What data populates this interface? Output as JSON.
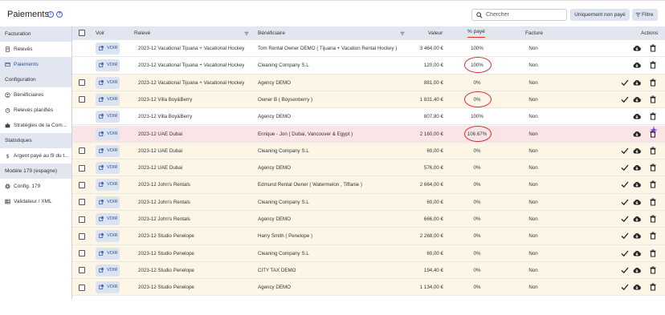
{
  "header": {
    "title": "Paiements",
    "info_glyph": "i",
    "help_glyph": "?",
    "search_placeholder": "Chercher",
    "unpaid_button": "Uniquement non payé",
    "filter_button": "Filtre"
  },
  "sidebar": {
    "sections": [
      {
        "label": "Facturation",
        "items": [
          {
            "label": "Relevés",
            "icon": "document-icon"
          },
          {
            "label": "Paiements",
            "icon": "card-icon",
            "active": true
          }
        ]
      },
      {
        "label": "Configuration",
        "items": [
          {
            "label": "Bénéficiaires",
            "icon": "person-icon"
          },
          {
            "label": "Relevés planifiés",
            "icon": "clock-icon"
          },
          {
            "label": "Stratégies de la Com...",
            "icon": "puzzle-icon"
          }
        ]
      },
      {
        "label": "Statistiques",
        "items": [
          {
            "label": "Argent payé au fil du t...",
            "icon": "dollar-icon"
          }
        ]
      },
      {
        "label": "Modèle 179 (espagne)",
        "items": [
          {
            "label": "Config. 179",
            "icon": "gear-icon"
          },
          {
            "label": "Validateur / XML",
            "icon": "table-icon"
          }
        ]
      }
    ]
  },
  "table": {
    "columns": {
      "voir": "Voir",
      "releve": "Relevé",
      "beneficiaire": "Bénéficiaire",
      "valeur": "Valeur",
      "pct": "% payé",
      "facture": "Facture",
      "actions": "Actions"
    },
    "voir_label": "VOIR",
    "rows": [
      {
        "releve": "2023-12 Vacational Tijuana + Vacational Hockey",
        "beneficiaire": "Tom Rental Owner DEMO ( Tijuana + Vacation Rental Hockey )",
        "valeur": "3 464,00 €",
        "pct": "100%",
        "facture": "Non",
        "bg": "white",
        "checkbox": false,
        "check": false
      },
      {
        "releve": "2023-12 Vacational Tijuana + Vacational Hockey",
        "beneficiaire": "Cleaning Company S.L",
        "valeur": "120,00 €",
        "pct": "100%",
        "facture": "Non",
        "bg": "white",
        "checkbox": false,
        "check": false,
        "circled": true
      },
      {
        "releve": "2023-12 Vacational Tijuana + Vacational Hockey",
        "beneficiaire": "Agency DEMO",
        "valeur": "881,00 €",
        "pct": "0%",
        "facture": "Non",
        "bg": "yellow",
        "checkbox": true,
        "check": true
      },
      {
        "releve": "2023-12 Villa Boy&Berry",
        "beneficiaire": "Owner B ( Boysenberry )",
        "valeur": "1 831,40 €",
        "pct": "0%",
        "facture": "Non",
        "bg": "yellow",
        "checkbox": true,
        "check": true,
        "circled": true
      },
      {
        "releve": "2023-12 Villa Boy&Berry",
        "beneficiaire": "Agency DEMO",
        "valeur": "807,80 €",
        "pct": "100%",
        "facture": "Non",
        "bg": "white",
        "checkbox": false,
        "check": false
      },
      {
        "releve": "2023-12 UAE Dubai",
        "beneficiaire": "Enrique - Jon ( Dubai, Vancouver & Egypt )",
        "valeur": "2 160,00 €",
        "pct": "106.67%",
        "facture": "Non",
        "bg": "pink",
        "checkbox": false,
        "check": false,
        "circled": true
      },
      {
        "releve": "2023-12 UAE Dubai",
        "beneficiaire": "Cleaning Company S.L",
        "valeur": "60,00 €",
        "pct": "0%",
        "facture": "Non",
        "bg": "yellow",
        "checkbox": true,
        "check": true
      },
      {
        "releve": "2023-12 UAE Dubai",
        "beneficiaire": "Agency DEMO",
        "valeur": "576,00 €",
        "pct": "0%",
        "facture": "Non",
        "bg": "yellow",
        "checkbox": true,
        "check": true
      },
      {
        "releve": "2023-12 John's Rentals",
        "beneficiaire": "Edmund Rental Owner ( Watermelon , Tiffanie )",
        "valeur": "2 664,00 €",
        "pct": "0%",
        "facture": "Non",
        "bg": "yellow",
        "checkbox": true,
        "check": true
      },
      {
        "releve": "2023-12 John's Rentals",
        "beneficiaire": "Cleaning Company S.L",
        "valeur": "60,00 €",
        "pct": "0%",
        "facture": "Non",
        "bg": "yellow",
        "checkbox": true,
        "check": true
      },
      {
        "releve": "2023-12 John's Rentals",
        "beneficiaire": "Agency DEMO",
        "valeur": "666,00 €",
        "pct": "0%",
        "facture": "Non",
        "bg": "yellow",
        "checkbox": true,
        "check": true
      },
      {
        "releve": "2023-12 Studio Penelope",
        "beneficiaire": "Harry Smith ( Penelope )",
        "valeur": "2 268,00 €",
        "pct": "0%",
        "facture": "Non",
        "bg": "yellow",
        "checkbox": true,
        "check": true
      },
      {
        "releve": "2023-12 Studio Penelope",
        "beneficiaire": "Cleaning Company S.L",
        "valeur": "60,00 €",
        "pct": "0%",
        "facture": "Non",
        "bg": "yellow",
        "checkbox": true,
        "check": true
      },
      {
        "releve": "2023-12 Studio Penelope",
        "beneficiaire": "CITY TAX DEMO",
        "valeur": "194,40 €",
        "pct": "0%",
        "facture": "Non",
        "bg": "yellow",
        "checkbox": true,
        "check": true
      },
      {
        "releve": "2023-12 Studio Penelope",
        "beneficiaire": "Agency DEMO",
        "valeur": "1 134,00 €",
        "pct": "0%",
        "facture": "Non",
        "bg": "yellow",
        "checkbox": true,
        "check": true
      }
    ]
  },
  "colors": {
    "accent": "#2f4f9f",
    "header_bg": "#e1e6f1",
    "unpaid_row": "#fdf6e6",
    "overpaid_row": "#fbe4e6",
    "annotation": "#d32f2f"
  }
}
